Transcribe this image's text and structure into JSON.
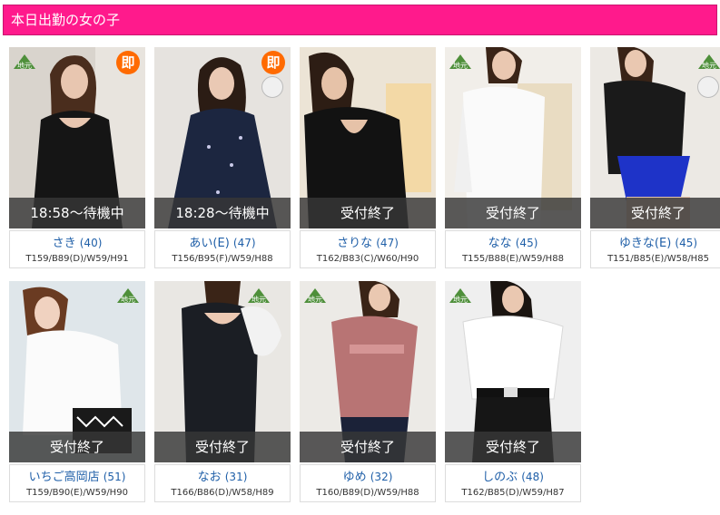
{
  "header": {
    "title": "本日出勤の女の子"
  },
  "colors": {
    "header_bg": "#ff1a8c",
    "name_text": "#1f5fa8",
    "status_bg": "#373737",
    "badge_soku": "#ff6a00"
  },
  "girls": [
    {
      "name": "さき",
      "age": "(40)",
      "measurements": "T159/B89(D)/W59/H91",
      "status": "18:58～待機中",
      "badges": [
        "jimoto-icon",
        "soku-icon"
      ],
      "soku": "即",
      "jimoto": "地元"
    },
    {
      "name": "あい(E)",
      "age": "(47)",
      "measurements": "T156/B95(F)/W59/H88",
      "status": "18:28～待機中",
      "badges": [
        "soku-icon",
        "economy-icon"
      ],
      "soku": "即"
    },
    {
      "name": "さりな",
      "age": "(47)",
      "measurements": "T162/B83(C)/W60/H90",
      "status": "受付終了",
      "badges": []
    },
    {
      "name": "なな",
      "age": "(45)",
      "measurements": "T155/B88(E)/W59/H88",
      "status": "受付終了",
      "badges": [
        "jimoto-icon"
      ],
      "jimoto": "地元"
    },
    {
      "name": "ゆきな(E)",
      "age": "(45)",
      "measurements": "T151/B85(E)/W58/H85",
      "status": "受付終了",
      "badges": [
        "jimoto-icon",
        "economy-icon"
      ],
      "jimoto": "地元"
    },
    {
      "name": "いちご高岡店",
      "age": "(51)",
      "measurements": "T159/B90(E)/W59/H90",
      "status": "受付終了",
      "badges": [
        "jimoto-icon"
      ],
      "jimoto": "地元"
    },
    {
      "name": "なお",
      "age": "(31)",
      "measurements": "T166/B86(D)/W58/H89",
      "status": "受付終了",
      "badges": [
        "jimoto-icon"
      ],
      "jimoto": "地元"
    },
    {
      "name": "ゆめ",
      "age": "(32)",
      "measurements": "T160/B89(D)/W59/H88",
      "status": "受付終了",
      "badges": [
        "jimoto-icon"
      ],
      "jimoto": "地元"
    },
    {
      "name": "しのぶ",
      "age": "(48)",
      "measurements": "T162/B85(D)/W59/H87",
      "status": "受付終了",
      "badges": [
        "jimoto-icon"
      ],
      "jimoto": "地元"
    }
  ]
}
